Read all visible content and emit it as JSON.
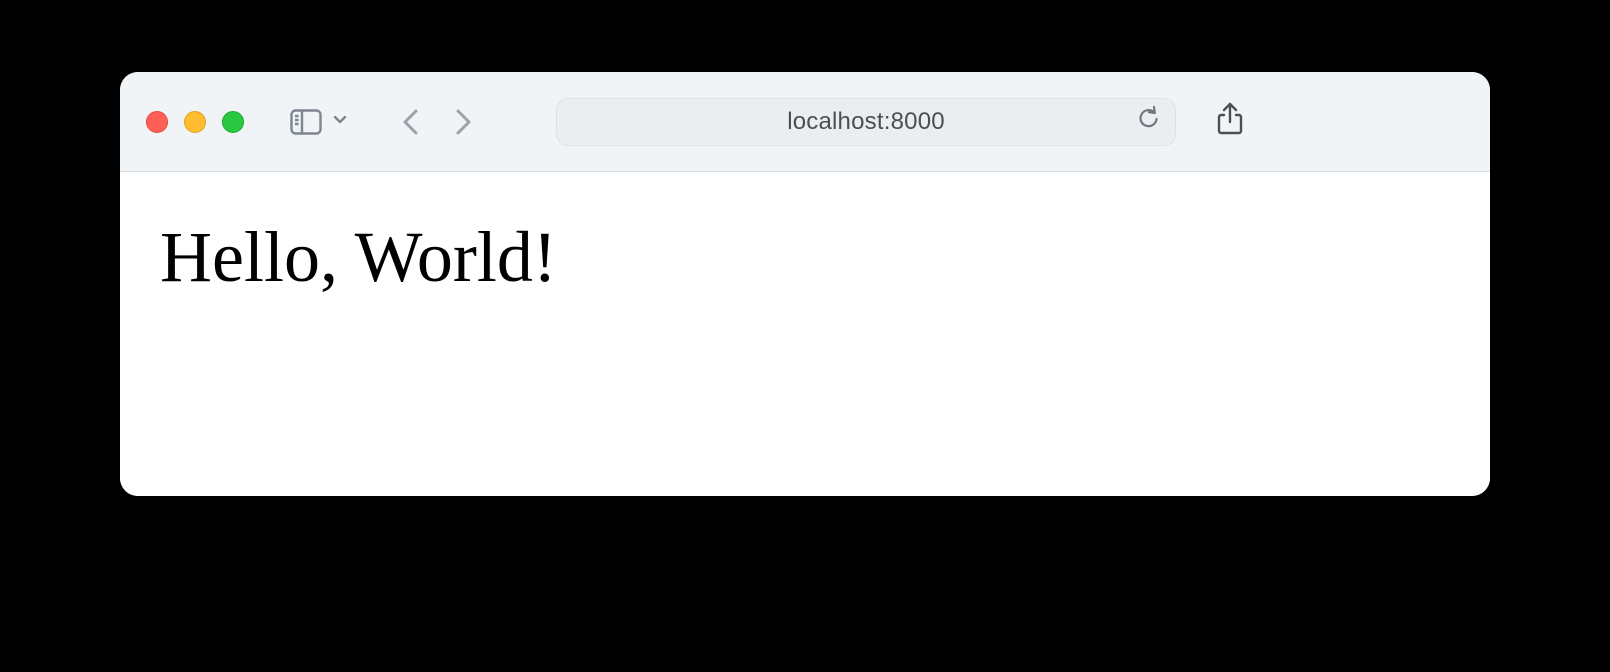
{
  "browser": {
    "address": "localhost:8000"
  },
  "page": {
    "heading": "Hello, World!"
  }
}
